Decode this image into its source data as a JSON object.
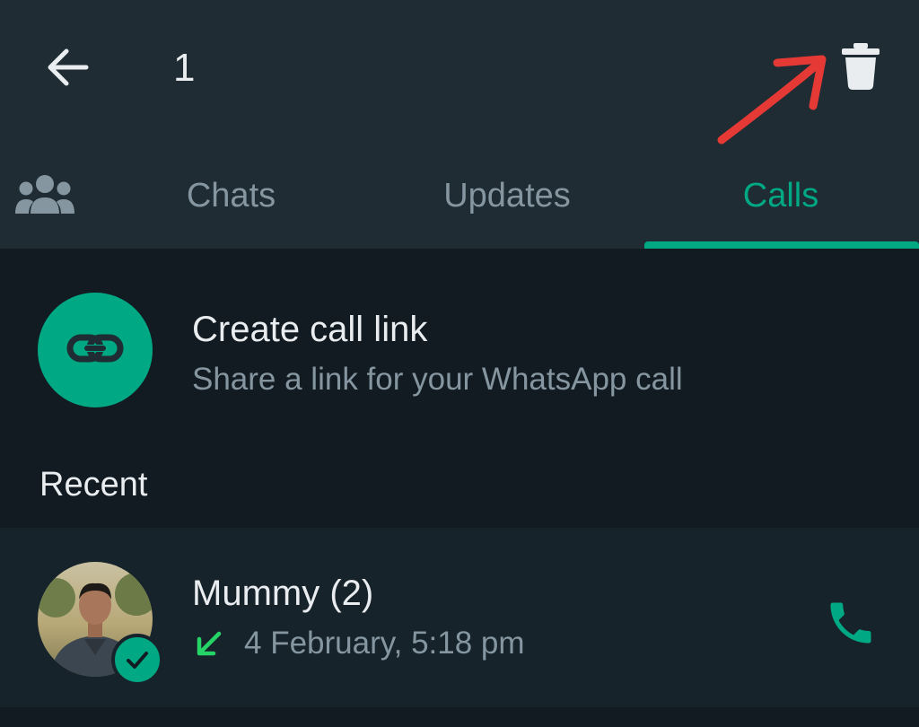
{
  "colors": {
    "accent": "#00a884",
    "annotation": "#e53935",
    "background": "#121b22",
    "header": "#1f2c34",
    "missed_incoming": "#25d366"
  },
  "selection_bar": {
    "back_icon": "arrow-left-icon",
    "selected_count": "1",
    "delete_icon": "trash-icon"
  },
  "tabs": {
    "community_icon": "community-icon",
    "items": [
      {
        "label": "Chats",
        "active": false
      },
      {
        "label": "Updates",
        "active": false
      },
      {
        "label": "Calls",
        "active": true
      }
    ]
  },
  "call_link": {
    "icon": "link-icon",
    "title": "Create call link",
    "subtitle": "Share a link for your WhatsApp call"
  },
  "recent": {
    "header": "Recent",
    "items": [
      {
        "name": "Mummy (2)",
        "direction_icon": "incoming-call-arrow-icon",
        "time": "4 February, 5:18 pm",
        "call_icon": "phone-icon",
        "selected": true
      }
    ]
  }
}
